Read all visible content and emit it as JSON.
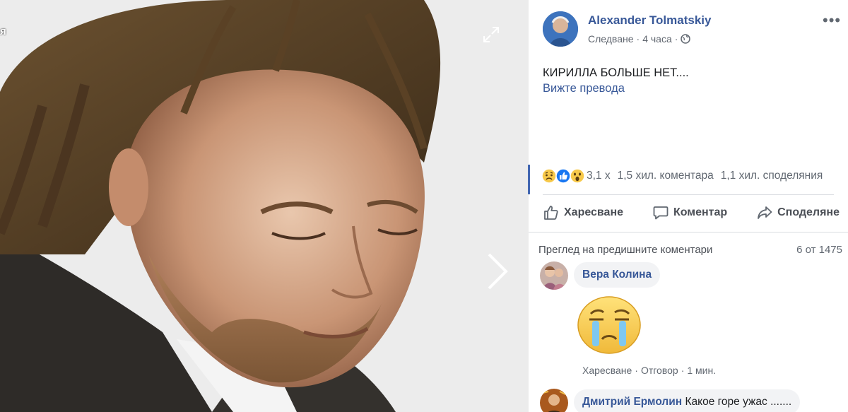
{
  "photo": {
    "label": "я"
  },
  "post": {
    "author": "Alexander Tolmatskiy",
    "follow": "Следване",
    "time": "4 часа",
    "text": "КИРИЛЛА БОЛЬШЕ НЕТ....",
    "see_translation": "Вижте превода"
  },
  "reactions": {
    "count": "3,1 х",
    "comments": "1,5 хил. коментара",
    "shares": "1,1 хил. споделяния"
  },
  "actions": {
    "like": "Харесване",
    "comment": "Коментар",
    "share": "Споделяне"
  },
  "comments_header": {
    "prev": "Преглед на предишните коментари",
    "count": "6 от 1475"
  },
  "comments": [
    {
      "author": "Вера Колина",
      "like": "Харесване",
      "reply": "Отговор",
      "time": "1 мин."
    },
    {
      "author": "Дмитрий Ермолин",
      "text": "Какое горе ужас ......."
    }
  ],
  "colors": {
    "link": "#385898",
    "accent": "#4267b2"
  }
}
